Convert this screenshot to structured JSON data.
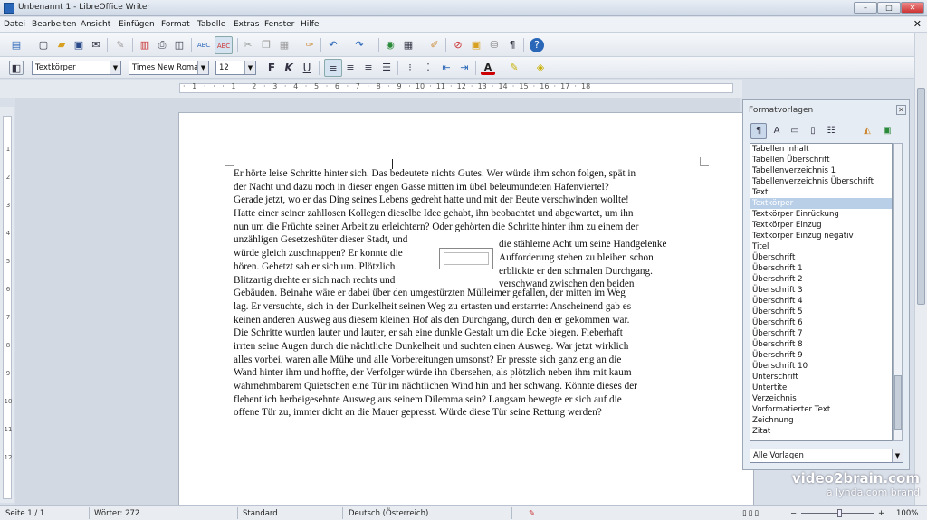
{
  "window": {
    "title": "Unbenannt 1 - LibreOffice Writer",
    "min": "–",
    "max": "□",
    "close": "✕"
  },
  "menu": {
    "items": [
      "Datei",
      "Bearbeiten",
      "Ansicht",
      "Einfügen",
      "Format",
      "Tabelle",
      "Extras",
      "Fenster",
      "Hilfe"
    ],
    "close": "✕"
  },
  "formatting": {
    "paragraph_style": "Textkörper",
    "font_name": "Times New Roman",
    "font_size": "12",
    "bold": "F",
    "italic": "K",
    "underline": "U"
  },
  "ruler": {
    "ticks": "·   1   ·   ·   ·   1   ·   2   ·   3   ·   4   ·   5   ·   6   ·   7   ·   8   ·   9   ·  10  ·  11  ·  12  ·  13  ·  14  ·  15  ·  16  ·  17  ·  18"
  },
  "vruler": {
    "ticks": [
      "1",
      "1",
      "2",
      "3",
      "4",
      "5",
      "6",
      "7",
      "8",
      "9",
      "10",
      "11",
      "12"
    ]
  },
  "document": {
    "lines_top": [
      "Er hörte leise Schritte hinter sich. Das bedeutete nichts Gutes. Wer würde ihm schon folgen, spät in",
      "der Nacht und dazu noch in dieser engen Gasse mitten im übel beleumundeten Hafenviertel?",
      "Gerade jetzt, wo er das Ding seines Lebens gedreht hatte und mit der Beute verschwinden wollte!",
      "Hatte einer seiner zahllosen Kollegen dieselbe Idee gehabt, ihn beobachtet und abgewartet, um ihn",
      "nun um die Früchte seiner Arbeit zu erleichtern? Oder gehörten die Schritte hinter ihm zu einem der"
    ],
    "lines_split": [
      {
        "left": "unzähligen Gesetzeshüter dieser Stadt, und",
        "right": "die stählerne Acht um seine Handgelenke"
      },
      {
        "left": "würde gleich zuschnappen? Er konnte die",
        "right": "Aufforderung stehen zu bleiben schon"
      },
      {
        "left": "hören. Gehetzt sah er sich um. Plötzlich",
        "right": "erblickte er den schmalen Durchgang."
      },
      {
        "left": "Blitzartig drehte er sich nach rechts und",
        "right": "verschwand zwischen den beiden"
      }
    ],
    "lines_bottom": [
      "Gebäuden. Beinahe wäre er dabei über den umgestürzten Mülleimer gefallen, der mitten im Weg",
      "lag. Er versuchte, sich in der Dunkelheit seinen Weg zu ertasten und erstarrte: Anscheinend gab es",
      "keinen anderen Ausweg aus diesem kleinen Hof als den Durchgang, durch den er gekommen war.",
      "Die Schritte wurden lauter und lauter, er sah eine dunkle Gestalt um die Ecke biegen. Fieberhaft",
      "irrten seine Augen durch die nächtliche Dunkelheit und suchten einen Ausweg. War jetzt wirklich",
      "alles vorbei, waren alle Mühe und alle Vorbereitungen umsonst? Er presste sich ganz eng an die",
      "Wand hinter ihm und hoffte, der Verfolger würde ihn übersehen, als plötzlich neben ihm mit kaum",
      "wahrnehmbarem Quietschen eine Tür im nächtlichen Wind hin und her schwang. Könnte dieses der",
      "flehentlich herbeigesehnte Ausweg aus seinem Dilemma sein? Langsam bewegte er sich auf die",
      "offene Tür zu, immer dicht an die Mauer gepresst. Würde diese Tür seine Rettung werden?"
    ]
  },
  "styles_panel": {
    "title": "Formatvorlagen",
    "close": "✕",
    "items": [
      "Tabellen Inhalt",
      "Tabellen Überschrift",
      "Tabellenverzeichnis 1",
      "Tabellenverzeichnis Überschrift",
      "Text",
      "Textkörper",
      "Textkörper Einrückung",
      "Textkörper Einzug",
      "Textkörper Einzug negativ",
      "Titel",
      "Überschrift",
      "Überschrift 1",
      "Überschrift 2",
      "Überschrift 3",
      "Überschrift 4",
      "Überschrift 5",
      "Überschrift 6",
      "Überschrift 7",
      "Überschrift 8",
      "Überschrift 9",
      "Überschrift 10",
      "Unterschrift",
      "Untertitel",
      "Verzeichnis",
      "Vorformatierter Text",
      "Zeichnung",
      "Zitat"
    ],
    "selected_index": 5,
    "filter": "Alle Vorlagen"
  },
  "status": {
    "page": "Seite 1 / 1",
    "words": "Wörter: 272",
    "page_style": "Standard",
    "language": "Deutsch (Österreich)",
    "zoom": "100%"
  },
  "watermark": {
    "line1": "video2brain.com",
    "line2": "a lynda.com brand"
  },
  "colors": {
    "accent": "#2a67b8",
    "selection": "#b9cfe8",
    "panel_bg": "#e6ecf3"
  }
}
